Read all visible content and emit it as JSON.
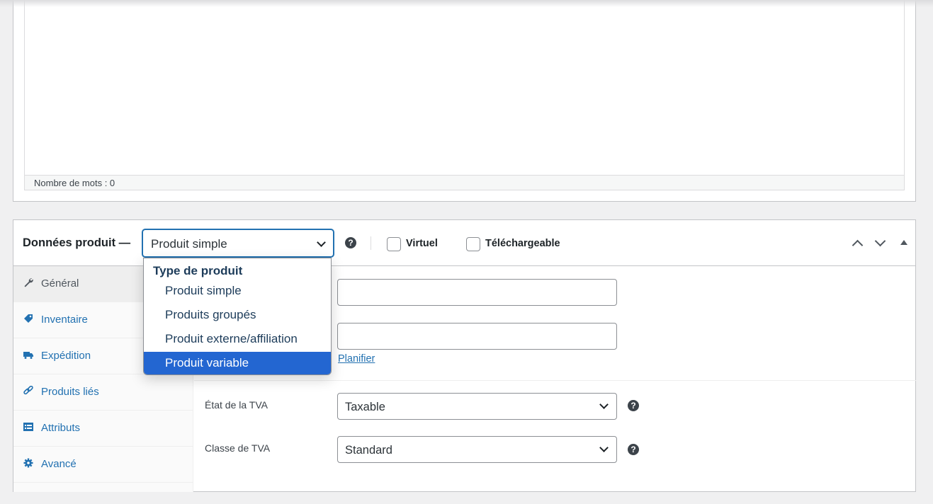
{
  "editor": {
    "word_count": "Nombre de mots : 0"
  },
  "product_data": {
    "title": "Données produit —",
    "type_select": {
      "value": "Produit simple",
      "group_label": "Type de produit",
      "options": [
        "Produit simple",
        "Produits groupés",
        "Produit externe/affiliation",
        "Produit variable"
      ],
      "highlighted": "Produit variable"
    },
    "help": "?",
    "virtual_label": "Virtuel",
    "downloadable_label": "Téléchargeable",
    "tabs": [
      {
        "label": "Général",
        "icon": "wrench-icon"
      },
      {
        "label": "Inventaire",
        "icon": "tag-icon"
      },
      {
        "label": "Expédition",
        "icon": "truck-icon"
      },
      {
        "label": "Produits liés",
        "icon": "link-icon"
      },
      {
        "label": "Attributs",
        "icon": "list-icon"
      },
      {
        "label": "Avancé",
        "icon": "gear-icon"
      }
    ],
    "schedule_link": "Planifier",
    "tax_status": {
      "label": "État de la TVA",
      "value": "Taxable"
    },
    "tax_class": {
      "label": "Classe de TVA",
      "value": "Standard"
    }
  },
  "colors": {
    "accent": "#2271b1",
    "selected_option": "#2366d1"
  }
}
